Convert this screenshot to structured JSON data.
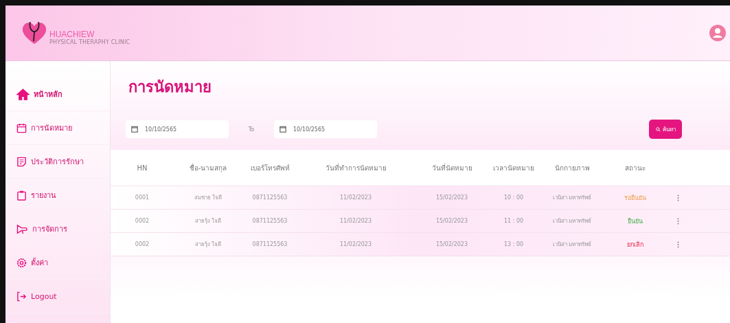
{
  "logo": {
    "name": "HUACHIEW",
    "tagline": "PHYSICAL THERAPHY CLINIC"
  },
  "sidebar": {
    "items": [
      {
        "label": "หน้าหลัก",
        "selected": true
      },
      {
        "label": "การนัดหมาย",
        "selected": false
      },
      {
        "label": "ประวัติการรักษา",
        "selected": false
      },
      {
        "label": "รายงาน",
        "selected": false
      },
      {
        "label": "การจัดการ",
        "selected": false
      },
      {
        "label": "ตั้งค่า",
        "selected": false
      },
      {
        "label": "Logout",
        "selected": false
      }
    ]
  },
  "page_title": "การนัดหมาย",
  "filter": {
    "from": "10/10/2565",
    "separator": "To",
    "to": "10/10/2565",
    "search_button": "ค้นหา"
  },
  "table": {
    "columns": [
      "HN",
      "ชื่อ-นามสกุล",
      "เบอร์โทรศัพท์",
      "วันที่ทำการนัดหมาย",
      "วันที่นัดหมาย",
      "เวลานัดหมาย",
      "นักกายภาพ",
      "สถานะ"
    ],
    "rows": [
      {
        "cells": [
          "0001",
          "สมชาย ใจดี",
          "0871125563",
          "11/02/2023",
          "15/02/2023",
          "10 : 00",
          "เวนิสา มหาทรัพย์"
        ],
        "status": "รอยืนยัน",
        "kind": "pending"
      },
      {
        "cells": [
          "0002",
          "สายรุ้ง ใจดี",
          "0871125563",
          "11/02/2023",
          "15/02/2023",
          "11 : 00",
          "เวนิสา มหาทรัพย์"
        ],
        "status": "ยืนยัน",
        "kind": "confirmed"
      },
      {
        "cells": [
          "0002",
          "สายรุ้ง ใจดี",
          "0871125563",
          "11/02/2023",
          "15/02/2023",
          "13 : 00",
          "เวนิสา มหาทรัพย์"
        ],
        "status": "ยกเลิก",
        "kind": "cancelled"
      }
    ]
  }
}
